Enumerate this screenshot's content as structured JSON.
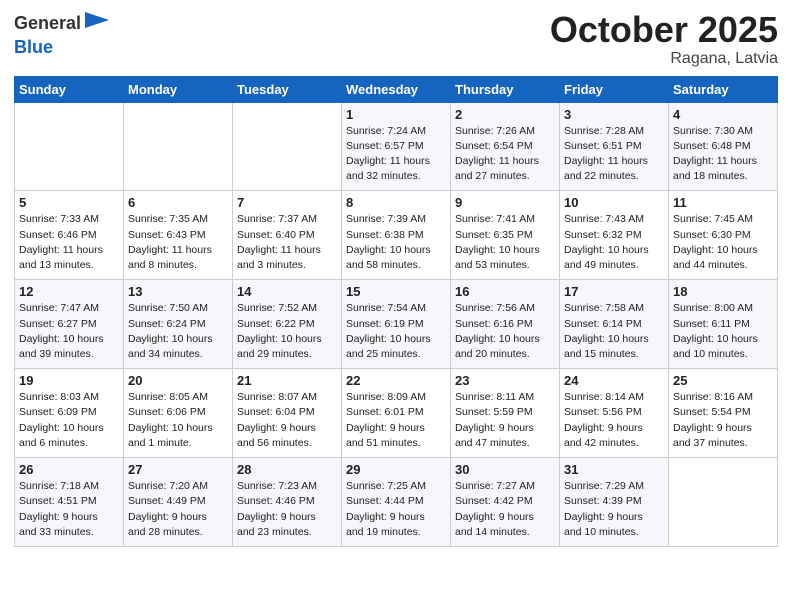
{
  "logo": {
    "general": "General",
    "blue": "Blue"
  },
  "header": {
    "month": "October 2025",
    "location": "Ragana, Latvia"
  },
  "weekdays": [
    "Sunday",
    "Monday",
    "Tuesday",
    "Wednesday",
    "Thursday",
    "Friday",
    "Saturday"
  ],
  "weeks": [
    [
      {
        "day": "",
        "info": ""
      },
      {
        "day": "",
        "info": ""
      },
      {
        "day": "",
        "info": ""
      },
      {
        "day": "1",
        "info": "Sunrise: 7:24 AM\nSunset: 6:57 PM\nDaylight: 11 hours\nand 32 minutes."
      },
      {
        "day": "2",
        "info": "Sunrise: 7:26 AM\nSunset: 6:54 PM\nDaylight: 11 hours\nand 27 minutes."
      },
      {
        "day": "3",
        "info": "Sunrise: 7:28 AM\nSunset: 6:51 PM\nDaylight: 11 hours\nand 22 minutes."
      },
      {
        "day": "4",
        "info": "Sunrise: 7:30 AM\nSunset: 6:48 PM\nDaylight: 11 hours\nand 18 minutes."
      }
    ],
    [
      {
        "day": "5",
        "info": "Sunrise: 7:33 AM\nSunset: 6:46 PM\nDaylight: 11 hours\nand 13 minutes."
      },
      {
        "day": "6",
        "info": "Sunrise: 7:35 AM\nSunset: 6:43 PM\nDaylight: 11 hours\nand 8 minutes."
      },
      {
        "day": "7",
        "info": "Sunrise: 7:37 AM\nSunset: 6:40 PM\nDaylight: 11 hours\nand 3 minutes."
      },
      {
        "day": "8",
        "info": "Sunrise: 7:39 AM\nSunset: 6:38 PM\nDaylight: 10 hours\nand 58 minutes."
      },
      {
        "day": "9",
        "info": "Sunrise: 7:41 AM\nSunset: 6:35 PM\nDaylight: 10 hours\nand 53 minutes."
      },
      {
        "day": "10",
        "info": "Sunrise: 7:43 AM\nSunset: 6:32 PM\nDaylight: 10 hours\nand 49 minutes."
      },
      {
        "day": "11",
        "info": "Sunrise: 7:45 AM\nSunset: 6:30 PM\nDaylight: 10 hours\nand 44 minutes."
      }
    ],
    [
      {
        "day": "12",
        "info": "Sunrise: 7:47 AM\nSunset: 6:27 PM\nDaylight: 10 hours\nand 39 minutes."
      },
      {
        "day": "13",
        "info": "Sunrise: 7:50 AM\nSunset: 6:24 PM\nDaylight: 10 hours\nand 34 minutes."
      },
      {
        "day": "14",
        "info": "Sunrise: 7:52 AM\nSunset: 6:22 PM\nDaylight: 10 hours\nand 29 minutes."
      },
      {
        "day": "15",
        "info": "Sunrise: 7:54 AM\nSunset: 6:19 PM\nDaylight: 10 hours\nand 25 minutes."
      },
      {
        "day": "16",
        "info": "Sunrise: 7:56 AM\nSunset: 6:16 PM\nDaylight: 10 hours\nand 20 minutes."
      },
      {
        "day": "17",
        "info": "Sunrise: 7:58 AM\nSunset: 6:14 PM\nDaylight: 10 hours\nand 15 minutes."
      },
      {
        "day": "18",
        "info": "Sunrise: 8:00 AM\nSunset: 6:11 PM\nDaylight: 10 hours\nand 10 minutes."
      }
    ],
    [
      {
        "day": "19",
        "info": "Sunrise: 8:03 AM\nSunset: 6:09 PM\nDaylight: 10 hours\nand 6 minutes."
      },
      {
        "day": "20",
        "info": "Sunrise: 8:05 AM\nSunset: 6:06 PM\nDaylight: 10 hours\nand 1 minute."
      },
      {
        "day": "21",
        "info": "Sunrise: 8:07 AM\nSunset: 6:04 PM\nDaylight: 9 hours\nand 56 minutes."
      },
      {
        "day": "22",
        "info": "Sunrise: 8:09 AM\nSunset: 6:01 PM\nDaylight: 9 hours\nand 51 minutes."
      },
      {
        "day": "23",
        "info": "Sunrise: 8:11 AM\nSunset: 5:59 PM\nDaylight: 9 hours\nand 47 minutes."
      },
      {
        "day": "24",
        "info": "Sunrise: 8:14 AM\nSunset: 5:56 PM\nDaylight: 9 hours\nand 42 minutes."
      },
      {
        "day": "25",
        "info": "Sunrise: 8:16 AM\nSunset: 5:54 PM\nDaylight: 9 hours\nand 37 minutes."
      }
    ],
    [
      {
        "day": "26",
        "info": "Sunrise: 7:18 AM\nSunset: 4:51 PM\nDaylight: 9 hours\nand 33 minutes."
      },
      {
        "day": "27",
        "info": "Sunrise: 7:20 AM\nSunset: 4:49 PM\nDaylight: 9 hours\nand 28 minutes."
      },
      {
        "day": "28",
        "info": "Sunrise: 7:23 AM\nSunset: 4:46 PM\nDaylight: 9 hours\nand 23 minutes."
      },
      {
        "day": "29",
        "info": "Sunrise: 7:25 AM\nSunset: 4:44 PM\nDaylight: 9 hours\nand 19 minutes."
      },
      {
        "day": "30",
        "info": "Sunrise: 7:27 AM\nSunset: 4:42 PM\nDaylight: 9 hours\nand 14 minutes."
      },
      {
        "day": "31",
        "info": "Sunrise: 7:29 AM\nSunset: 4:39 PM\nDaylight: 9 hours\nand 10 minutes."
      },
      {
        "day": "",
        "info": ""
      }
    ]
  ]
}
